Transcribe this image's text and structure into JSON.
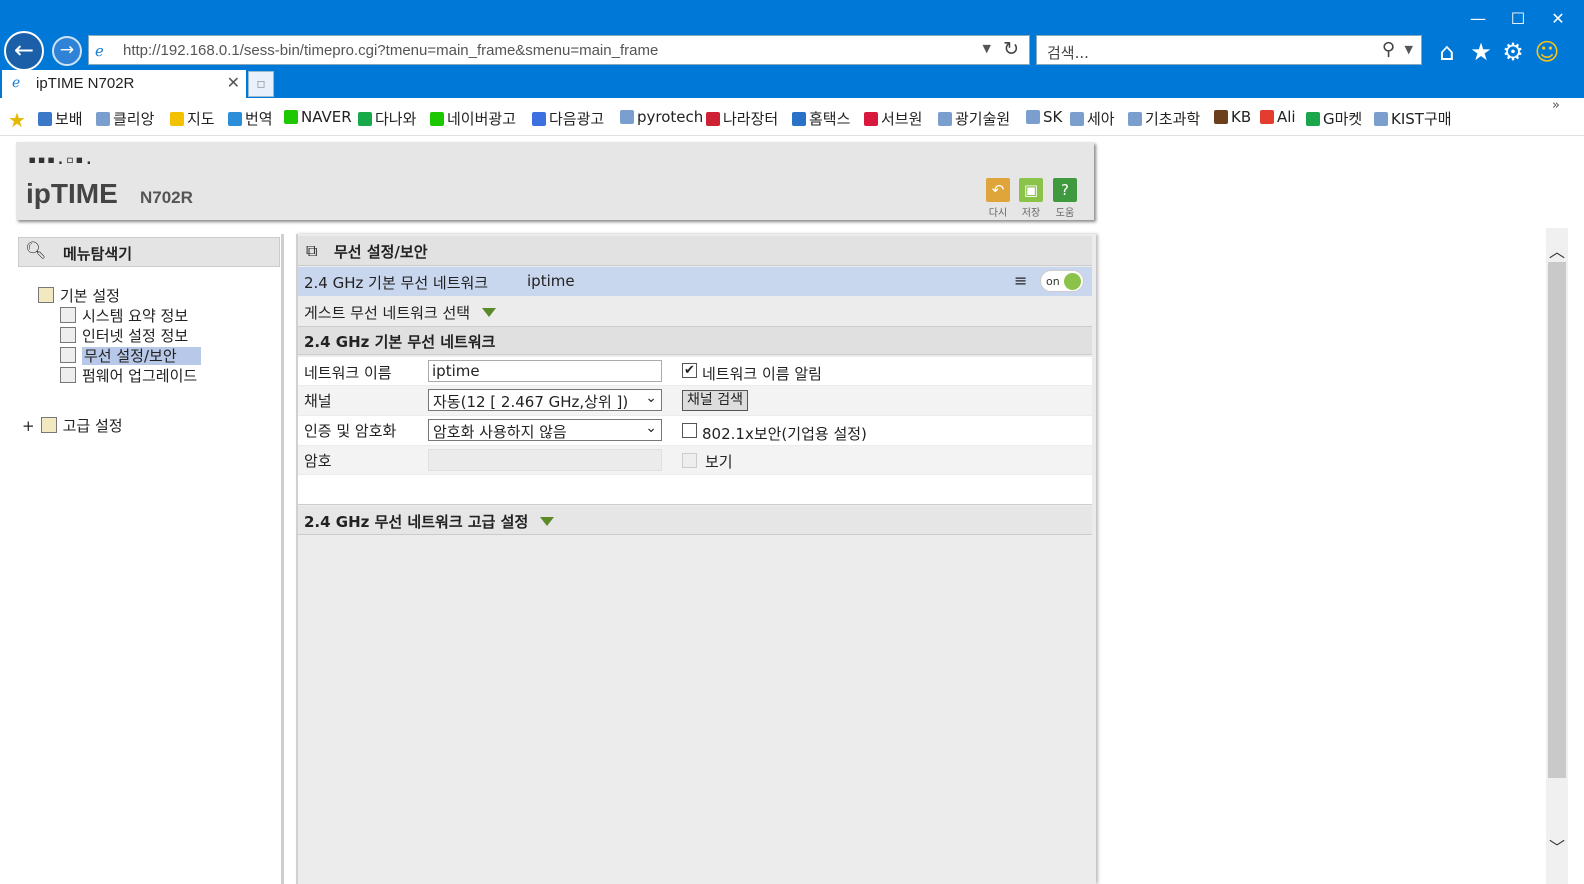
{
  "browser": {
    "url": "http://192.168.0.1/sess-bin/timepro.cgi?tmenu=main_frame&smenu=main_frame",
    "search_placeholder": "검색...",
    "tab_title": "ipTIME N702R",
    "window_controls": [
      "—",
      "☐",
      "✕"
    ]
  },
  "favorites": [
    "보배",
    "클리앙",
    "지도",
    "번역",
    "NAVER",
    "다나와",
    "네이버광고",
    "다음광고",
    "pyrotech",
    "나라장터",
    "홈택스",
    "서브원",
    "광기술원",
    "SK",
    "세아",
    "기초과학",
    "KB",
    "Ali",
    "G마켓",
    "KIST구매"
  ],
  "header": {
    "logo_dots": "▪▪▪.▫▪.",
    "brand": "ipTIME",
    "model": "N702R",
    "buttons": [
      {
        "label": "다시",
        "icon": "undo-icon",
        "color": "#e0a53a"
      },
      {
        "label": "저장",
        "icon": "save-icon",
        "color": "#8bc34a"
      },
      {
        "label": "도움",
        "icon": "help-icon",
        "color": "#3f9a3f"
      }
    ]
  },
  "nav": {
    "title": "메뉴탐색기",
    "basic": "기본 설정",
    "items": [
      "시스템 요약 정보",
      "인터넷 설정 정보",
      "무선 설정/보안",
      "펌웨어 업그레이드"
    ],
    "advanced_toggle": "+",
    "advanced": "고급 설정"
  },
  "main": {
    "title": "무선 설정/보안",
    "network_row": {
      "label": "2.4 GHz 기본 무선 네트워크",
      "ssid": "iptime",
      "toggle": "on"
    },
    "guest_label": "게스트 무선 네트워크 선택",
    "section_title": "2.4 GHz 기본 무선 네트워크",
    "fields": {
      "name_label": "네트워크 이름",
      "name_value": "iptime",
      "broadcast_label": "네트워크 이름 알림",
      "broadcast_checked": "✔",
      "channel_label": "채널",
      "channel_value": "자동(12 [ 2.467 GHz,상위 ])",
      "channel_search": "채널 검색",
      "auth_label": "인증 및 암호화",
      "auth_value": "암호화 사용하지 않음",
      "dot1x_label": "802.1x보안(기업용 설정)",
      "password_label": "암호",
      "show_label": "보기"
    },
    "advanced_title": "2.4 GHz 무선 네트워크 고급 설정"
  },
  "colors": {
    "titlebar": "#0078d7",
    "selected_row": "#c8d6ee",
    "toggle_on": "#8bc34a"
  }
}
